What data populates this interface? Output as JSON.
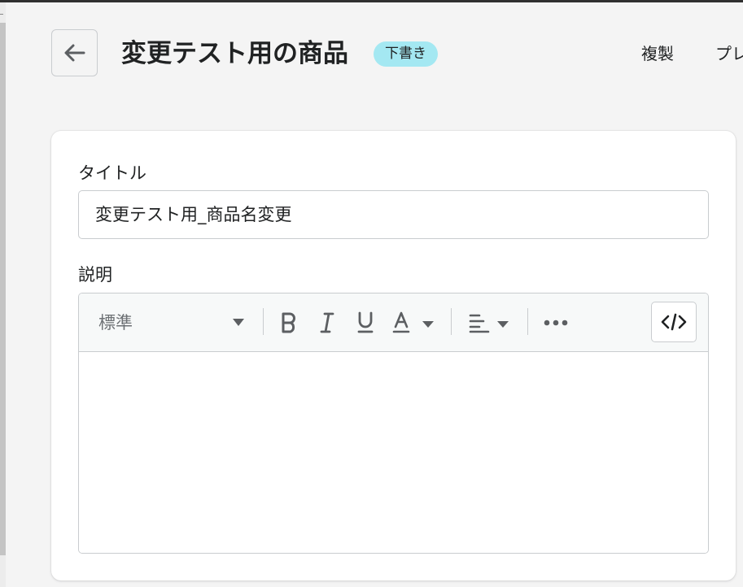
{
  "header": {
    "back_icon": "arrow-left-icon",
    "title": "変更テスト用の商品",
    "status_badge": "下書き",
    "status_color": "#a4e8f2",
    "actions": [
      "複製",
      "プレ"
    ]
  },
  "form": {
    "title_label": "タイトル",
    "title_value": "変更テスト用_商品名変更",
    "description_label": "説明",
    "editor": {
      "format_value": "標準",
      "toolbar_icons": [
        "chevron-down-icon",
        "bold-icon",
        "italic-icon",
        "underline-icon",
        "text-color-icon",
        "align-left-icon",
        "more-icon",
        "code-icon"
      ],
      "content": ""
    }
  }
}
